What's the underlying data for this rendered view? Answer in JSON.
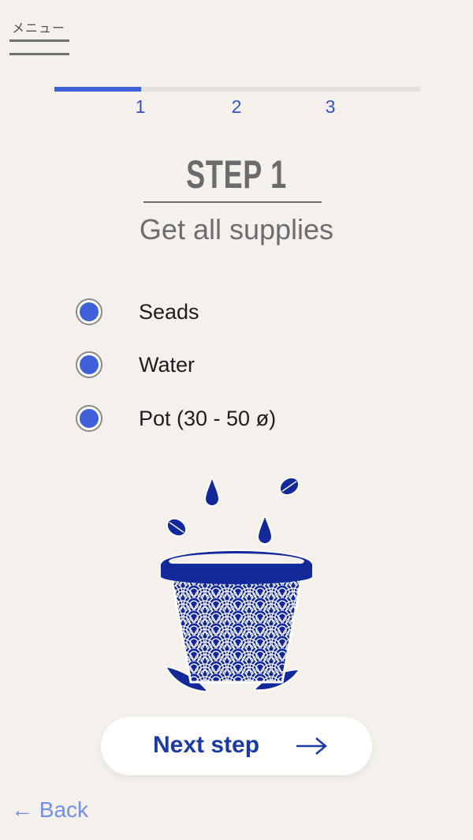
{
  "menu": {
    "label": "メニュー"
  },
  "progress": {
    "fraction": 0.238,
    "steps": [
      "1",
      "2",
      "3"
    ],
    "accent_color": "#3f60d8"
  },
  "step": {
    "title": "STEP 1",
    "subtitle": "Get all supplies"
  },
  "supplies": [
    {
      "label": "Seads",
      "checked": true
    },
    {
      "label": "Water",
      "checked": true
    },
    {
      "label": "Pot (30 - 50 ø)",
      "checked": true
    }
  ],
  "illustration": {
    "icon": "flower-pot-with-seeds-and-water-drops-icon",
    "color": "#13299a"
  },
  "actions": {
    "next_label": "Next step",
    "next_icon": "arrow-right-icon",
    "back_label": "← Back"
  }
}
